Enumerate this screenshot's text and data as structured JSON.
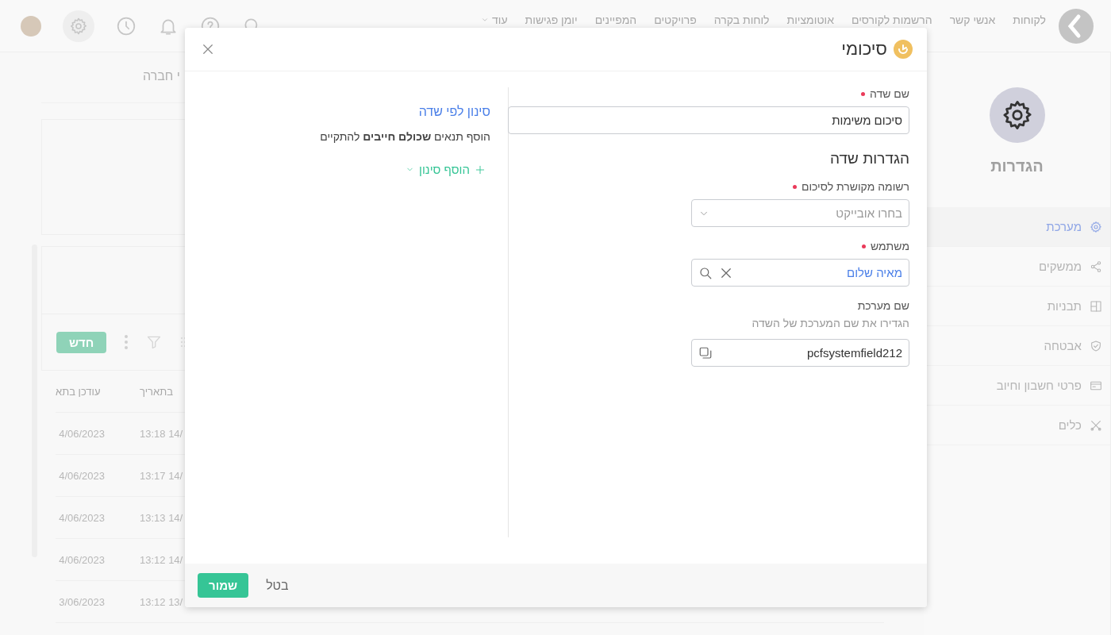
{
  "topbar": {
    "nav": [
      "לקוחות",
      "אנשי קשר",
      "הרשמות לקורסים",
      "אוטומציות",
      "לוחות בקרה",
      "פרויקטים",
      "המפיינים",
      "יומן פגישות",
      "עוד"
    ]
  },
  "sidebar": {
    "title": "הגדרות",
    "items": [
      {
        "label": "מערכת",
        "selected": true
      },
      {
        "label": "ממשקים",
        "selected": false
      },
      {
        "label": "תבניות",
        "selected": false
      },
      {
        "label": "אבטחה",
        "selected": false
      },
      {
        "label": "פרטי חשבון וחיוב",
        "selected": false
      },
      {
        "label": "כלים",
        "selected": false
      }
    ]
  },
  "background": {
    "page_title": "י חברה",
    "new_button": "חדש",
    "table": {
      "columns": [
        "בתאריך",
        "עודכן בתא"
      ],
      "rows": [
        [
          "13:18 14/",
          "4/06/2023"
        ],
        [
          "13:17 14/",
          "4/06/2023"
        ],
        [
          "13:13 14/",
          "4/06/2023"
        ],
        [
          "13:12 14/",
          "4/06/2023"
        ],
        [
          "13:12 13/",
          "3/06/2023"
        ]
      ]
    }
  },
  "modal": {
    "title": "סיכומי",
    "fields": [
      {
        "kind": "text",
        "label": "שם שדה",
        "required": true,
        "value": "סיכום משימות"
      },
      {
        "kind": "heading",
        "label": "הגדרות שדה"
      },
      {
        "kind": "select",
        "label": "רשומה מקושרת לסיכום",
        "required": true,
        "placeholder": "בחרו אובייקט"
      },
      {
        "kind": "user",
        "label": "משתמש",
        "required": true,
        "value": "מאיה שלום"
      },
      {
        "kind": "system",
        "label": "שם מערכת",
        "required": false,
        "hint": "הגדירו את שם המערכת של השדה",
        "value": "pcfsystemfield212"
      }
    ],
    "filter": {
      "title": "סינון לפי שדה",
      "description": "הוסף תנאים **שכולם חייבים** להתקיים",
      "add_button": "הוסף סינון"
    },
    "footer": {
      "cancel": "בטל",
      "save": "שמור"
    }
  }
}
